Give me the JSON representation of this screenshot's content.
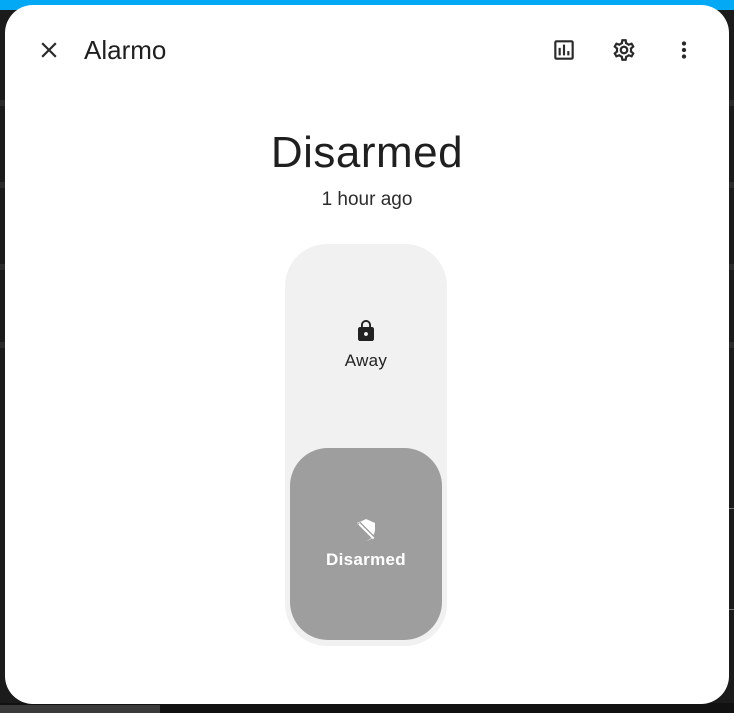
{
  "dialog": {
    "title": "Alarmo"
  },
  "state": {
    "label": "Disarmed",
    "last_changed": "1 hour ago"
  },
  "modes": [
    {
      "label": "Away",
      "icon": "lock-icon",
      "selected": false
    },
    {
      "label": "Disarmed",
      "icon": "shield-off-icon",
      "selected": true
    }
  ],
  "colors": {
    "selected_mode": "#9e9e9e",
    "control_background": "#f1f1f1",
    "header_accent": "#03a9f4"
  }
}
